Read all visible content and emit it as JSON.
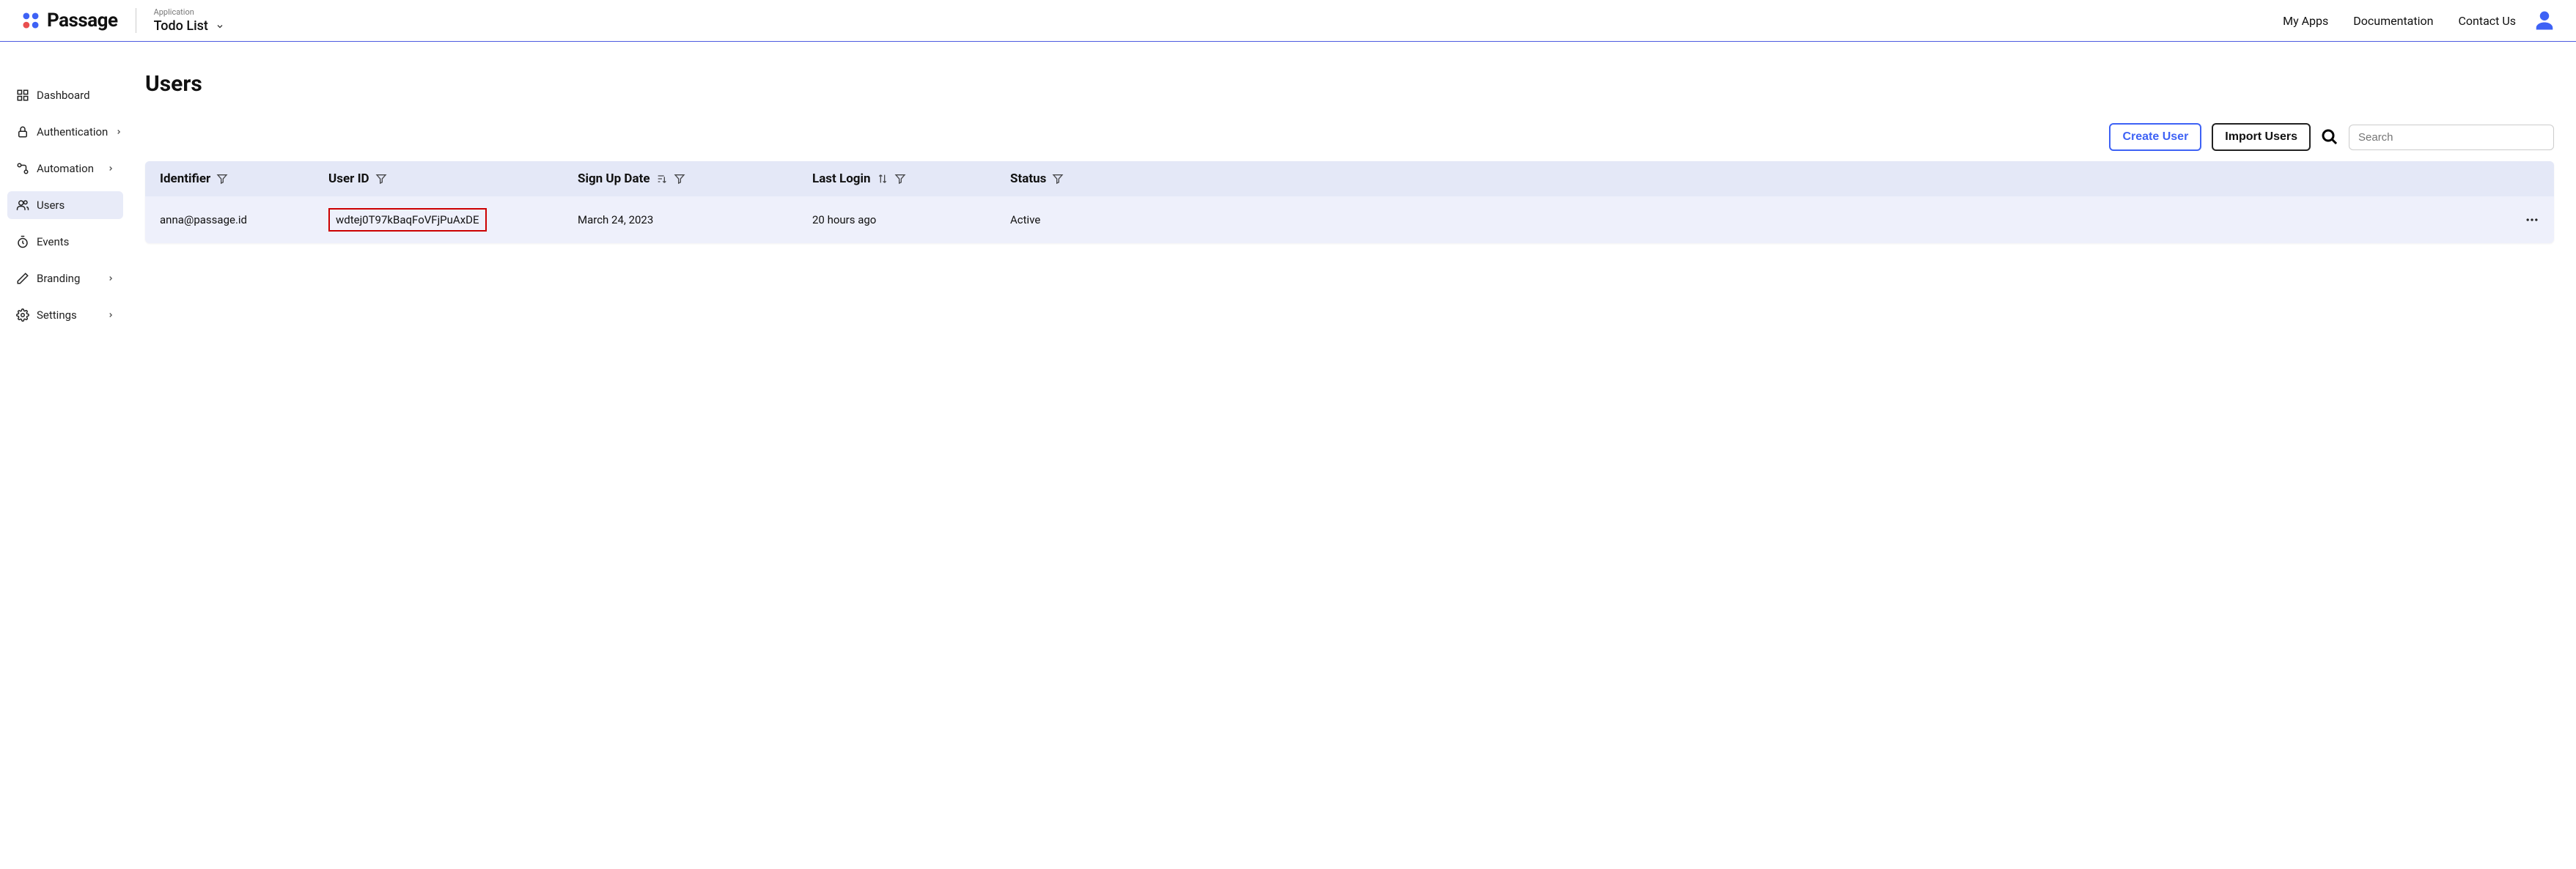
{
  "brand": {
    "name": "Passage"
  },
  "app_selector": {
    "label": "Application",
    "current": "Todo List"
  },
  "topnav": {
    "my_apps": "My Apps",
    "docs": "Documentation",
    "contact": "Contact Us"
  },
  "sidebar": {
    "items": [
      {
        "label": "Dashboard",
        "expandable": false
      },
      {
        "label": "Authentication",
        "expandable": true
      },
      {
        "label": "Automation",
        "expandable": true
      },
      {
        "label": "Users",
        "expandable": false
      },
      {
        "label": "Events",
        "expandable": false
      },
      {
        "label": "Branding",
        "expandable": true
      },
      {
        "label": "Settings",
        "expandable": true
      }
    ],
    "active_index": 3
  },
  "page": {
    "title": "Users"
  },
  "toolbar": {
    "create_user": "Create User",
    "import_users": "Import Users",
    "search_placeholder": "Search"
  },
  "table": {
    "columns": {
      "identifier": "Identifier",
      "user_id": "User ID",
      "sign_up": "Sign Up Date",
      "last_login": "Last Login",
      "status": "Status"
    },
    "rows": [
      {
        "identifier": "anna@passage.id",
        "user_id": "wdtej0T97kBaqFoVFjPuAxDE",
        "sign_up": "March 24, 2023",
        "last_login": "20 hours ago",
        "status": "Active"
      }
    ]
  }
}
